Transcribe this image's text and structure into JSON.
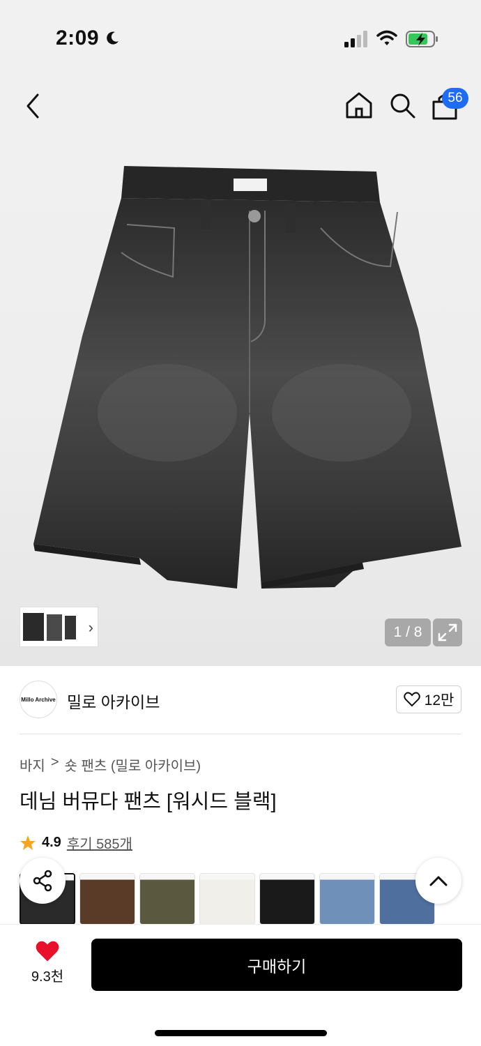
{
  "status_bar": {
    "time": "2:09",
    "icons": [
      "moon-icon",
      "signal-icon",
      "wifi-icon",
      "battery-charging-icon"
    ]
  },
  "nav": {
    "icons": [
      "back-icon",
      "home-icon",
      "search-icon",
      "shopping-bag-icon"
    ],
    "cart_count": "56"
  },
  "gallery": {
    "page_counter": "1 / 8",
    "icons": [
      "chevron-right-icon",
      "expand-icon"
    ]
  },
  "brand": {
    "logo_text": "Millo Archive",
    "name": "밀로 아카이브",
    "likes": "12만"
  },
  "breadcrumb": {
    "category": "바지",
    "separator": ">",
    "subcategory": "숏 팬츠 (밀로 아카이브)"
  },
  "product": {
    "title": "데님 버뮤다 팬츠 [워시드 블랙]",
    "rating": "4.9",
    "reviews": "후기 585개"
  },
  "swatches": [
    {
      "color": "#2a2a2a",
      "selected": true
    },
    {
      "color": "#5a3b27"
    },
    {
      "color": "#5b5840"
    },
    {
      "color": "#f1efe9"
    },
    {
      "color": "#1a1a1a"
    },
    {
      "color": "#6f90b8"
    },
    {
      "color": "#4f6f9e"
    }
  ],
  "bottom": {
    "like_count": "9.3천",
    "buy_label": "구매하기"
  },
  "colors": {
    "accent_badge": "#1d6cf3",
    "heart": "#e8102b",
    "star": "#f5a623"
  }
}
